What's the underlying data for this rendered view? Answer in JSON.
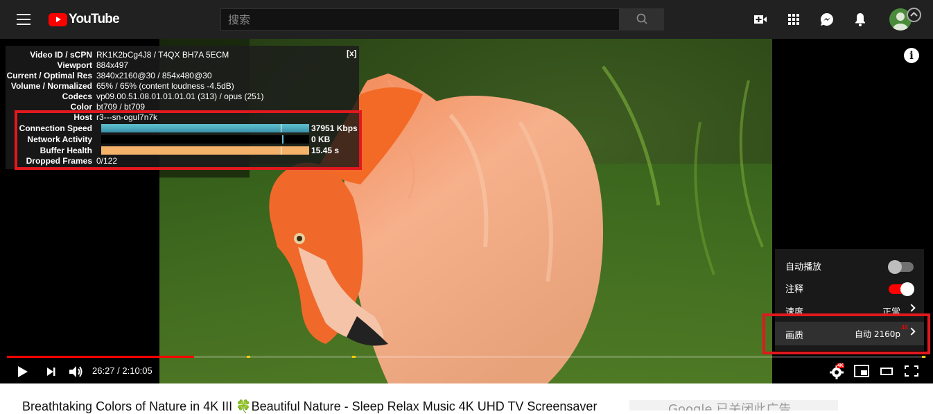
{
  "app": {
    "logo_text": "YouTube"
  },
  "search": {
    "placeholder": "搜索"
  },
  "stats": {
    "close_label": "[x]",
    "rows": [
      {
        "label": "Video ID / sCPN",
        "value": "RK1K2bCg4J8 / T4QX BH7A 5ECM"
      },
      {
        "label": "Viewport",
        "value": "884x497"
      },
      {
        "label": "Current / Optimal Res",
        "value": "3840x2160@30 / 854x480@30"
      },
      {
        "label": "Volume / Normalized",
        "value": "65% / 65% (content loudness -4.5dB)"
      },
      {
        "label": "Codecs",
        "value": "vp09.00.51.08.01.01.01.01 (313) / opus (251)"
      },
      {
        "label": "Color",
        "value": "bt709 / bt709"
      },
      {
        "label": "Host",
        "value": "r3---sn-ogul7n7k"
      }
    ],
    "connection_speed": {
      "label": "Connection Speed",
      "value": "37951 Kbps"
    },
    "network_activity": {
      "label": "Network Activity",
      "value": "0 KB"
    },
    "buffer_health": {
      "label": "Buffer Health",
      "value": "15.45 s"
    },
    "dropped_frames": {
      "label": "Dropped Frames",
      "value": "0/122"
    }
  },
  "settings": {
    "autoplay_label": "自动播放",
    "autoplay_on": false,
    "annotations_label": "注释",
    "annotations_on": true,
    "speed_label": "速度",
    "speed_value": "正常",
    "quality_label": "画质",
    "quality_value": "自动 2160p",
    "quality_badge": "4K"
  },
  "controls": {
    "current_time": "26:27",
    "duration": "2:10:05",
    "time_display": "26:27 / 2:10:05",
    "progress_fraction": 0.2034,
    "hd_badge": "4K"
  },
  "colors": {
    "accent": "#ff0000",
    "highlight_box": "#e1191e",
    "connection_bar": "#4aa3b8",
    "buffer_bar": "#f5b26b"
  },
  "below": {
    "video_title": "Breathtaking Colors of Nature in 4K III 🍀Beautiful Nature - Sleep Relax Music 4K UHD TV Screensaver",
    "ad_text": "Google 已关闭此广告"
  }
}
